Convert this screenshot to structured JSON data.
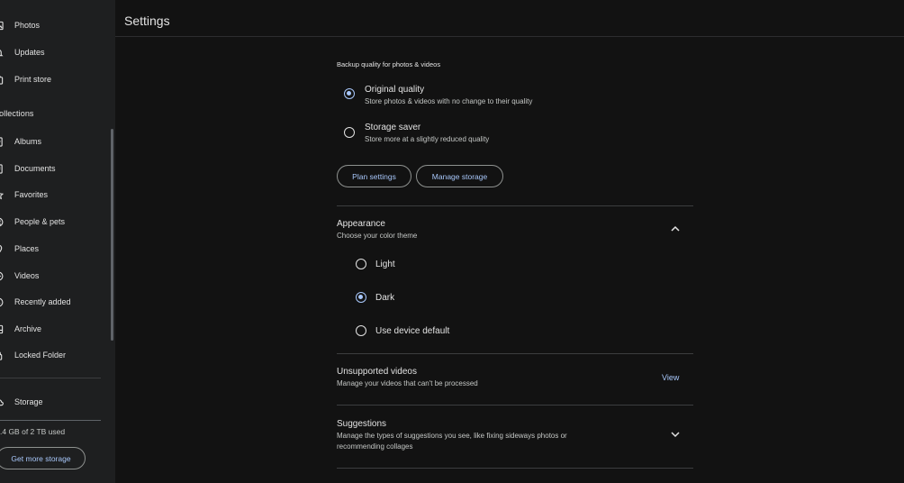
{
  "sidebar": {
    "items_top": [
      {
        "label": "Photos",
        "icon": "photos-icon"
      },
      {
        "label": "Updates",
        "icon": "bell-icon"
      },
      {
        "label": "Print store",
        "icon": "print-store-icon"
      }
    ],
    "collections_title": "ollections",
    "items_collections": [
      {
        "label": "Albums",
        "icon": "albums-icon"
      },
      {
        "label": "Documents",
        "icon": "documents-icon"
      },
      {
        "label": "Favorites",
        "icon": "star-icon"
      },
      {
        "label": "People & pets",
        "icon": "people-icon"
      },
      {
        "label": "Places",
        "icon": "place-pin-icon"
      },
      {
        "label": "Videos",
        "icon": "play-icon"
      },
      {
        "label": "Recently added",
        "icon": "clock-icon"
      },
      {
        "label": "Archive",
        "icon": "archive-icon"
      },
      {
        "label": "Locked Folder",
        "icon": "lock-icon"
      }
    ],
    "storage": {
      "label": "Storage",
      "icon": "cloud-icon"
    },
    "storage_used": ".4 GB of 2 TB used",
    "get_more_storage": "Get more storage"
  },
  "header": {
    "title": "Settings"
  },
  "backup": {
    "label": "Backup quality for photos & videos",
    "options": [
      {
        "title": "Original quality",
        "desc": "Store photos & videos with no change to their quality",
        "selected": true
      },
      {
        "title": "Storage saver",
        "desc": "Store more at a slightly reduced quality",
        "selected": false
      }
    ],
    "plan_settings": "Plan settings",
    "manage_storage": "Manage storage"
  },
  "appearance": {
    "title": "Appearance",
    "desc": "Choose your color theme",
    "options": [
      {
        "label": "Light",
        "selected": false
      },
      {
        "label": "Dark",
        "selected": true
      },
      {
        "label": "Use device default",
        "selected": false
      }
    ]
  },
  "unsupported": {
    "title": "Unsupported videos",
    "desc": "Manage your videos that can't be processed",
    "action": "View"
  },
  "suggestions": {
    "title": "Suggestions",
    "desc_line1": "Manage the types of suggestions you see, like fixing sideways photos or",
    "desc_line2": "recommending collages"
  },
  "colors": {
    "accent": "#a8c7fa",
    "background": "#121212",
    "sidebar": "#1e1f20"
  }
}
